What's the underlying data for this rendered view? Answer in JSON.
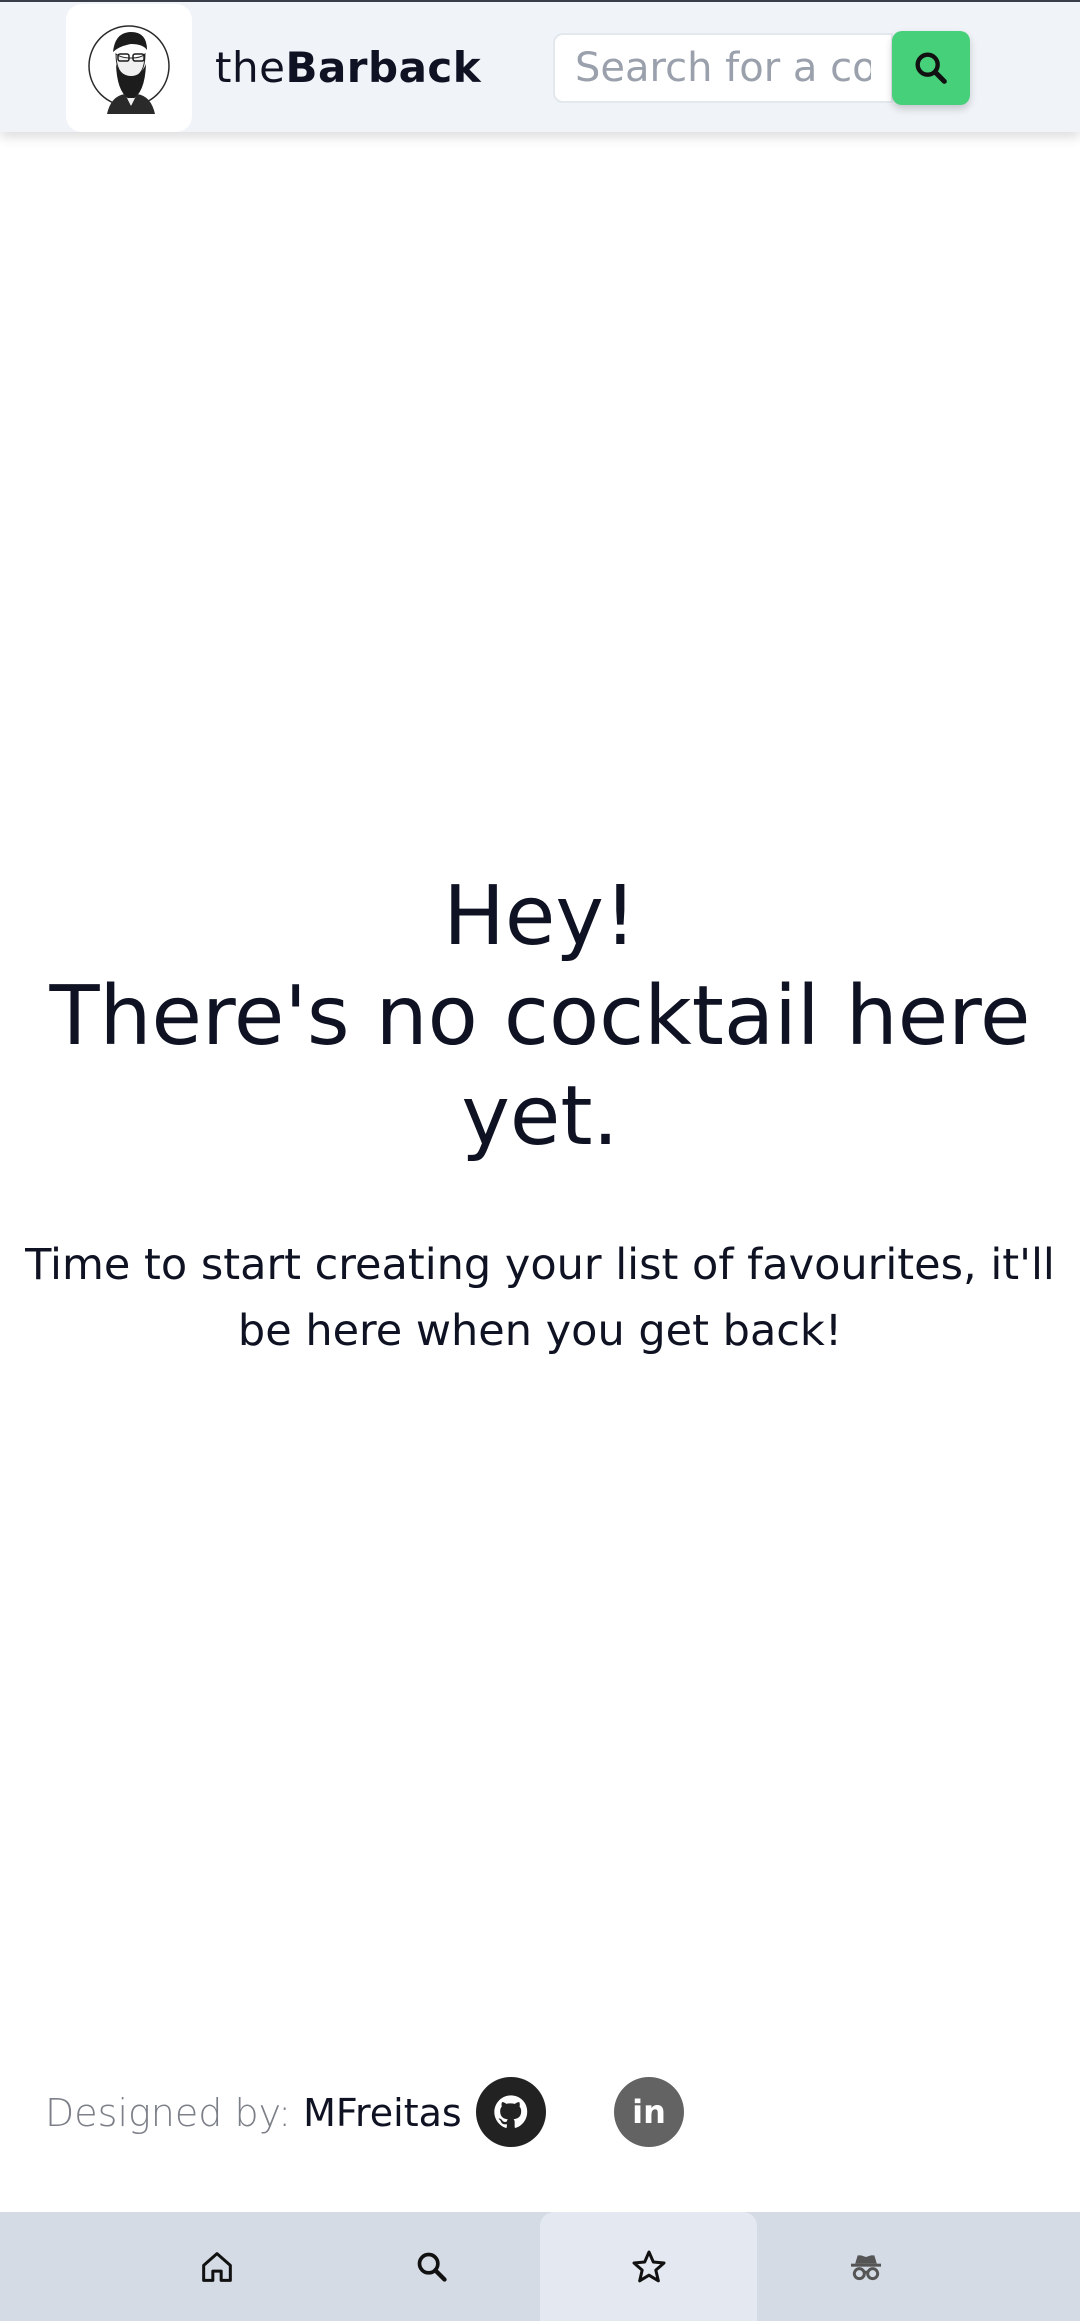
{
  "header": {
    "brand_prefix": "the",
    "brand_name": "Barback",
    "logo_icon": "bearded-man-avatar",
    "search_placeholder": "Search for a cocktail",
    "search_value": "",
    "search_button_icon": "search-icon",
    "accent_color": "#47d07a"
  },
  "empty_state": {
    "line1": "Hey!",
    "line2": "There's no cocktail here yet.",
    "subtitle": "Time to start creating your list of favourites, it'll be here when you get back!"
  },
  "footer": {
    "credit_label": "Designed by:",
    "credit_name": "MFreitas",
    "github_icon": "github-icon",
    "linkedin_text": "in"
  },
  "bottom_nav": {
    "items": [
      {
        "icon": "home-icon",
        "active": false
      },
      {
        "icon": "search-icon",
        "active": false
      },
      {
        "icon": "star-icon",
        "active": true
      },
      {
        "icon": "incognito-icon",
        "active": false
      }
    ]
  }
}
